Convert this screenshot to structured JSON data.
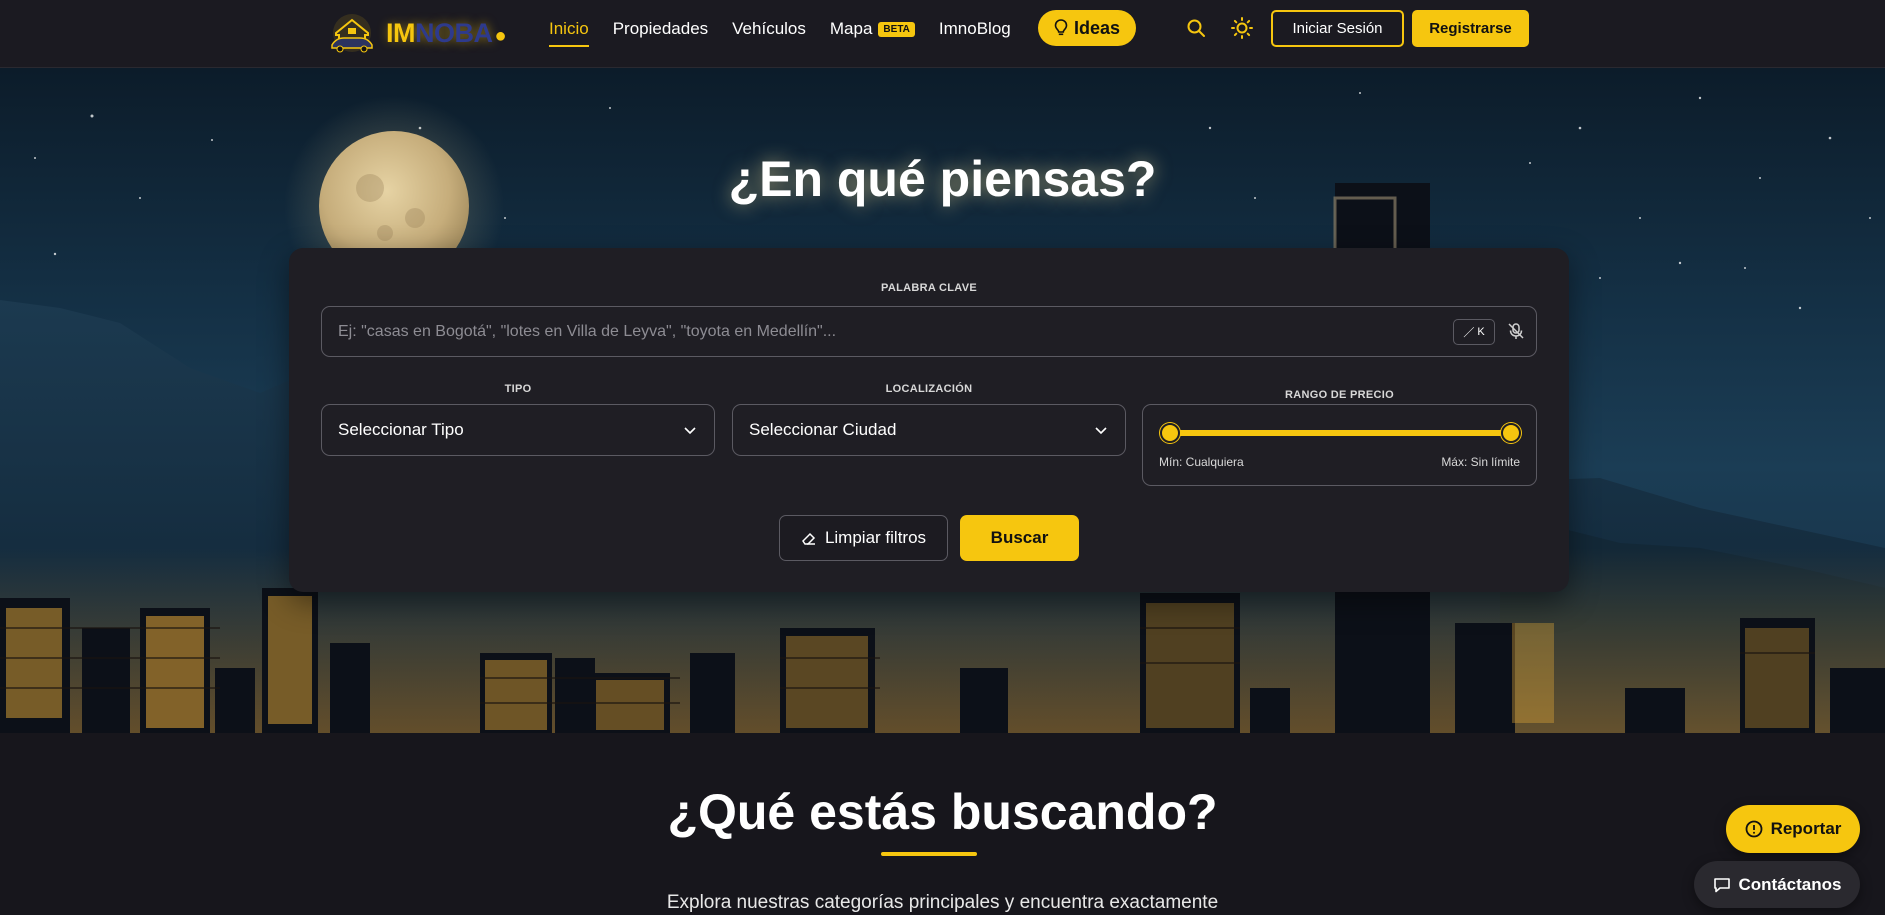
{
  "brand": {
    "logo_im": "IM",
    "logo_noba": "NOBA",
    "accent_color": "#f6c60f"
  },
  "nav": {
    "links": [
      {
        "label": "Inicio",
        "active": true
      },
      {
        "label": "Propiedades"
      },
      {
        "label": "Vehículos"
      },
      {
        "label": "Mapa",
        "badge": "BETA"
      },
      {
        "label": "ImnoBlog"
      }
    ],
    "ideas_label": "Ideas",
    "search_icon": "search-icon",
    "theme_icon": "sun-icon",
    "login_label": "Iniciar Sesión",
    "register_label": "Registrarse"
  },
  "hero": {
    "title": "¿En qué piensas?"
  },
  "search": {
    "keyword_label": "PALABRA CLAVE",
    "keyword_placeholder": "Ej: \"casas en Bogotá\", \"lotes en Villa de Leyva\", \"toyota en Medellín\"...",
    "shortcut_key": "K",
    "type_label": "TIPO",
    "type_value": "Seleccionar Tipo",
    "location_label": "LOCALIZACIÓN",
    "location_value": "Seleccionar Ciudad",
    "price_label": "RANGO DE PRECIO",
    "price_min": "Mín: Cualquiera",
    "price_max": "Máx: Sin límite",
    "price_range_fraction": [
      0.0,
      1.0
    ],
    "clear_label": "Limpiar filtros",
    "submit_label": "Buscar"
  },
  "section": {
    "title": "¿Qué estás buscando?",
    "subtitle": "Explora nuestras categorías principales y encuentra exactamente"
  },
  "floating": {
    "report_label": "Reportar",
    "contact_label": "Contáctanos"
  }
}
